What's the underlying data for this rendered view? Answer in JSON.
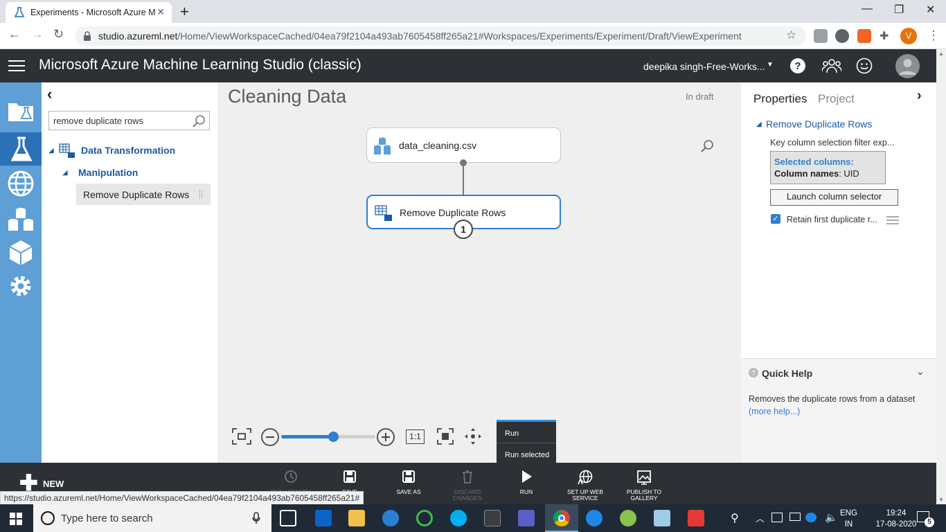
{
  "browser": {
    "tab_title": "Experiments - Microsoft Azure Machine Learning Studio",
    "url_host": "studio.azureml.net",
    "url_path": "/Home/ViewWorkspaceCached/04ea79f2104a493ab7605458ff265a21#Workspaces/Experiments/Experiment/Draft/ViewExperiment",
    "profile_initial": "V",
    "new_tab": "+",
    "close_tab": "✕"
  },
  "header": {
    "app_title": "Microsoft Azure Machine Learning Studio (classic)",
    "user": "deepika singh-Free-Works..."
  },
  "palette": {
    "collapse_glyph": "‹",
    "search_value": "remove duplicate rows",
    "category": "Data Transformation",
    "subcategory": "Manipulation",
    "module": "Remove Duplicate Rows"
  },
  "canvas": {
    "title": "Cleaning Data",
    "status": "In draft",
    "nodes": [
      {
        "label": "data_cleaning.csv"
      },
      {
        "label": "Remove Duplicate Rows",
        "badge": "1"
      }
    ],
    "zoom_one_to_one": "1:1",
    "zoom_level": 0.55
  },
  "properties": {
    "tab_properties": "Properties",
    "tab_project": "Project",
    "module_title": "Remove Duplicate Rows",
    "key_label": "Key column selection filter exp...",
    "selected_columns_label": "Selected columns:",
    "column_names_label": "Column names",
    "column_names_value": ": UID",
    "launch_button": "Launch column selector",
    "retain_label": "Retain first duplicate r...",
    "retain_checked": true
  },
  "quick_help": {
    "title": "Quick Help",
    "text": "Removes the duplicate rows from a dataset",
    "link": "(more help...)"
  },
  "run_menu": {
    "run": "Run",
    "run_selected": "Run selected"
  },
  "commands": {
    "new": "NEW",
    "run_history": "RUN HISTORY",
    "save": "SAVE",
    "save_as": "SAVE AS",
    "discard": "DISCARD CHANGES",
    "run": "RUN",
    "setup_web_service_1": "SET UP WEB",
    "setup_web_service_2": "SERVICE",
    "publish_1": "PUBLISH TO",
    "publish_2": "GALLERY"
  },
  "status_url": "https://studio.azureml.net/Home/ViewWorkspaceCached/04ea79f2104a493ab7605458ff265a21#",
  "taskbar": {
    "search_placeholder": "Type here to search",
    "lang1": "ENG",
    "lang2": "IN",
    "time": "19:24",
    "date": "17-08-2020",
    "notif_count": "5"
  },
  "colors": {
    "rail": "#5e9fd5",
    "rail_active": "#2a71b8",
    "header": "#2d3035",
    "accent": "#2f7fcf",
    "link": "#1b5aa5"
  }
}
